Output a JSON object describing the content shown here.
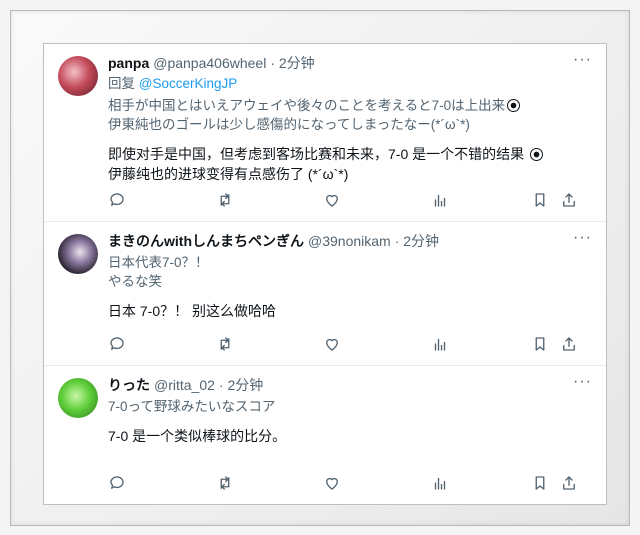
{
  "tweets": [
    {
      "name": "panpa",
      "handle": "@panpa406wheel",
      "time": "· 2分钟",
      "reply_prefix": "回复",
      "reply_to": "@SoccerKingJP",
      "original": [
        "相手が中国とはいえアウェイや後々のことを考えると7-0は上出来",
        "伊東純也のゴールは少し感傷的になってしまったなー(*´ω`*)"
      ],
      "translation": [
        "即使对手是中国，但考虑到客场比赛和未来，7-0 是一个不错的结果",
        "伊藤纯也的进球变得有点感伤了 (*´ω`*)"
      ]
    },
    {
      "name": "まきのんwithしんまちペンぎん",
      "handle": "@39nonikam",
      "time": "· 2分钟",
      "original": [
        "日本代表7-0？！",
        "やるな笑"
      ],
      "translation": [
        "日本 7-0？！ 别这么做哈哈"
      ]
    },
    {
      "name": "りった",
      "handle": "@ritta_02",
      "time": "· 2分钟",
      "original": [
        "7-0って野球みたいなスコア"
      ],
      "translation": [
        "7-0 是一个类似棒球的比分。"
      ]
    }
  ],
  "more_label": "···"
}
